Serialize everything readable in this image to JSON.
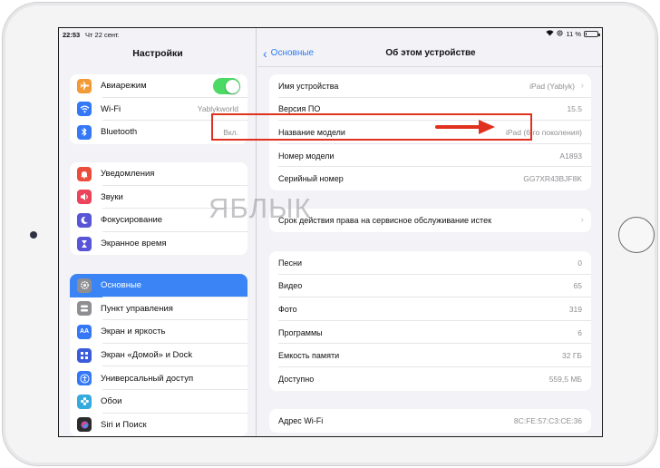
{
  "status": {
    "time": "22:53",
    "date": "Чт 22 сент.",
    "battery": "11 %",
    "battery_level": 0.11
  },
  "sidebar": {
    "title": "Настройки",
    "groups": [
      [
        {
          "label": "Авиарежим",
          "icon": "airplane-icon",
          "color": "#f19a37",
          "toggle": true
        },
        {
          "label": "Wi-Fi",
          "icon": "wifi-icon",
          "color": "#3478f6",
          "value": "Yablykworld"
        },
        {
          "label": "Bluetooth",
          "icon": "bluetooth-icon",
          "color": "#3478f6",
          "value": "Вкл."
        }
      ],
      [
        {
          "label": "Уведомления",
          "icon": "bell-icon",
          "color": "#eb4d3d"
        },
        {
          "label": "Звуки",
          "icon": "speaker-icon",
          "color": "#eb445a"
        },
        {
          "label": "Фокусирование",
          "icon": "moon-icon",
          "color": "#5856d6"
        },
        {
          "label": "Экранное время",
          "icon": "hourglass-icon",
          "color": "#5856d6"
        }
      ],
      [
        {
          "label": "Основные",
          "icon": "gear-icon",
          "color": "#8e8e93",
          "selected": true
        },
        {
          "label": "Пункт управления",
          "icon": "switches-icon",
          "color": "#8e8e93"
        },
        {
          "label": "Экран и яркость",
          "icon": "text-size-icon",
          "color": "#3478f6"
        },
        {
          "label": "Экран «Домой» и Dock",
          "icon": "grid-icon",
          "color": "#3b5bdb"
        },
        {
          "label": "Универсальный доступ",
          "icon": "accessibility-icon",
          "color": "#3478f6"
        },
        {
          "label": "Обои",
          "icon": "flower-icon",
          "color": "#35aadc"
        },
        {
          "label": "Siri и Поиск",
          "icon": "siri-icon",
          "color": "#2b2b2b"
        }
      ]
    ]
  },
  "detail": {
    "back_label": "Основные",
    "title": "Об этом устройстве",
    "groups": [
      [
        {
          "label": "Имя устройства",
          "value": "iPad (Yablyk)",
          "chevron": true
        },
        {
          "label": "Версия ПО",
          "value": "15.5"
        },
        {
          "label": "Название модели",
          "value": "iPad (6-го поколения)"
        },
        {
          "label": "Номер модели",
          "value": "A1893"
        },
        {
          "label": "Серийный номер",
          "value": "GG7XR43BJF8K"
        }
      ],
      [
        {
          "label": "Срок действия права на сервисное обслуживание истек",
          "chevron": true
        }
      ],
      [
        {
          "label": "Песни",
          "value": "0"
        },
        {
          "label": "Видео",
          "value": "65"
        },
        {
          "label": "Фото",
          "value": "319"
        },
        {
          "label": "Программы",
          "value": "6"
        },
        {
          "label": "Емкость памяти",
          "value": "32 ГБ"
        },
        {
          "label": "Доступно",
          "value": "559,5 МБ"
        }
      ],
      [
        {
          "label": "Адрес Wi-Fi",
          "value": "8C:FE:57:C3:CE:36"
        }
      ]
    ]
  },
  "watermark": "ЯБЛЫК",
  "colors": {
    "accent": "#2f7cf6",
    "selected": "#3a84f5",
    "highlight": "#e0301e",
    "toggle_on": "#4cd964"
  }
}
